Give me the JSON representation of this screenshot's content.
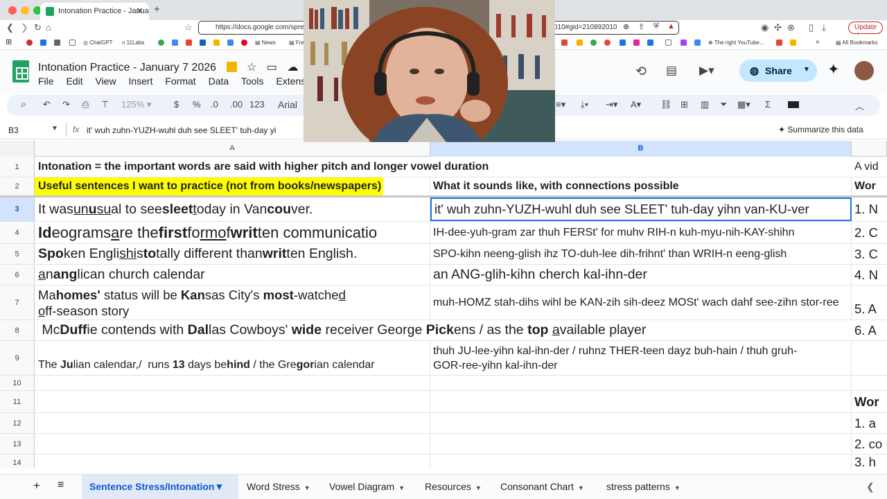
{
  "browser": {
    "tab_title": "Intonation Practice - January",
    "url": "https://docs.google.com/spre",
    "url_tail": "010#gid=210892010",
    "update_label": "Update",
    "all_bookmarks": "All Bookmarks",
    "bookmarks": [
      "ChatGPT",
      "11Labs",
      "News",
      "Fre",
      "The right YouTube..."
    ]
  },
  "sheet": {
    "title": "Intonation Practice - January 7 2026",
    "menu": [
      "File",
      "Edit",
      "View",
      "Insert",
      "Format",
      "Data",
      "Tools",
      "Extensions"
    ],
    "share_label": "Share",
    "zoom": "125%",
    "currency": "$",
    "percent": "%",
    "dec_less": ".0",
    "dec_more": ".00",
    "number_fmt": "123",
    "font": "Arial",
    "cell_ref": "B3",
    "formula_text": "it' wuh zuhn-YUZH-wuhl duh see SLEET' tuh-day yi",
    "summarize": "Summarize this data"
  },
  "columns": [
    "A",
    "B"
  ],
  "rows": [
    {
      "num": "1",
      "a": "Intonation = the important words are said with higher pitch and longer vowel duration",
      "b": "",
      "c": "A vid"
    },
    {
      "num": "2",
      "a": "Useful sentences I want to practice (not from books/newspapers)",
      "b": "What it sounds like, with connections possible",
      "c": "Wor"
    },
    {
      "num": "3",
      "a_parts": [
        "It was ",
        "un",
        "u",
        "su",
        "al to see ",
        "sleet",
        " ",
        "t",
        "oday in Van",
        "cou",
        "ver."
      ],
      "b": "it' wuh zuhn-YUZH-wuhl duh see SLEET' tuh-day yihn van-KU-ver",
      "c": "1. N"
    },
    {
      "num": "4",
      "a_parts": [
        "Id",
        "eograms ",
        "a",
        "re the ",
        "first",
        " fo",
        "rm ",
        "o",
        "f ",
        "writ",
        "ten communicatio"
      ],
      "b": "IH-dee-yuh-gram zar thuh FERSt' for muhv RIH-n kuh-myu-nih-KAY-shihn",
      "c": "2. C"
    },
    {
      "num": "5",
      "a_parts": [
        "Spo",
        "ken Engli",
        "sh ",
        "i",
        "s ",
        "to",
        "tally different than ",
        "writ",
        "ten English."
      ],
      "b": "SPO-kihn neeng-glish ihz TO-duh-lee dih-frihnt' than WRIH-n eeng-glish",
      "c": "3. C"
    },
    {
      "num": "6",
      "a_parts": [
        "a",
        "n ",
        "ang",
        "lican church calendar"
      ],
      "b": "an ANG-glih-kihn cherch kal-ihn-der",
      "c": "4. N"
    },
    {
      "num": "7",
      "a_line1_parts": [
        "Ma",
        "homes'",
        " status will be ",
        "Kan",
        "sas City's ",
        "most",
        "-watche",
        "d"
      ],
      "a_line2_parts": [
        "o",
        "ff-season story"
      ],
      "b": "muh-HOMZ stah-dihs wihl be KAN-zih sih-deez MOSt' wach dahf see-zihn stor-ree",
      "c": "5. A"
    },
    {
      "num": "8",
      "a_parts": [
        " Mc",
        "Duff",
        "ie contends with ",
        "Dal",
        "las Cowboys' ",
        "wide",
        " receiver George ",
        "Pick",
        "ens / as the ",
        "top",
        " ",
        "a",
        "vailable player"
      ],
      "b": "",
      "c": "6. A"
    },
    {
      "num": "9",
      "a_parts": [
        "The ",
        "Ju",
        "lian calendar,/  runs ",
        "13",
        " days be",
        "hind",
        " / the Gre",
        "gor",
        "ian calendar"
      ],
      "b": "thuh JU-lee-yihn kal-ihn-der / ruhnz THER-teen dayz buh-hain / thuh gruh-GOR-ree-yihn kal-ihn-der",
      "c": ""
    },
    {
      "num": "10",
      "a": "",
      "b": "",
      "c": ""
    },
    {
      "num": "11",
      "a": "",
      "b": "",
      "c": "Wor"
    },
    {
      "num": "12",
      "a": "",
      "b": "",
      "c": "1. a"
    },
    {
      "num": "13",
      "a": "",
      "b": "",
      "c": "2. co"
    },
    {
      "num": "14",
      "a": "",
      "b": "",
      "c": "3. h"
    }
  ],
  "sheet_tabs": [
    "Sentence Stress/Intonation",
    "Word Stress",
    "Vowel Diagram",
    "Resources",
    "Consonant Chart",
    "stress patterns"
  ],
  "colors": {
    "accent": "#0b57d0",
    "sheets_green": "#1ea362",
    "highlight": "#ffff00",
    "share_bg": "#c2e7ff"
  }
}
